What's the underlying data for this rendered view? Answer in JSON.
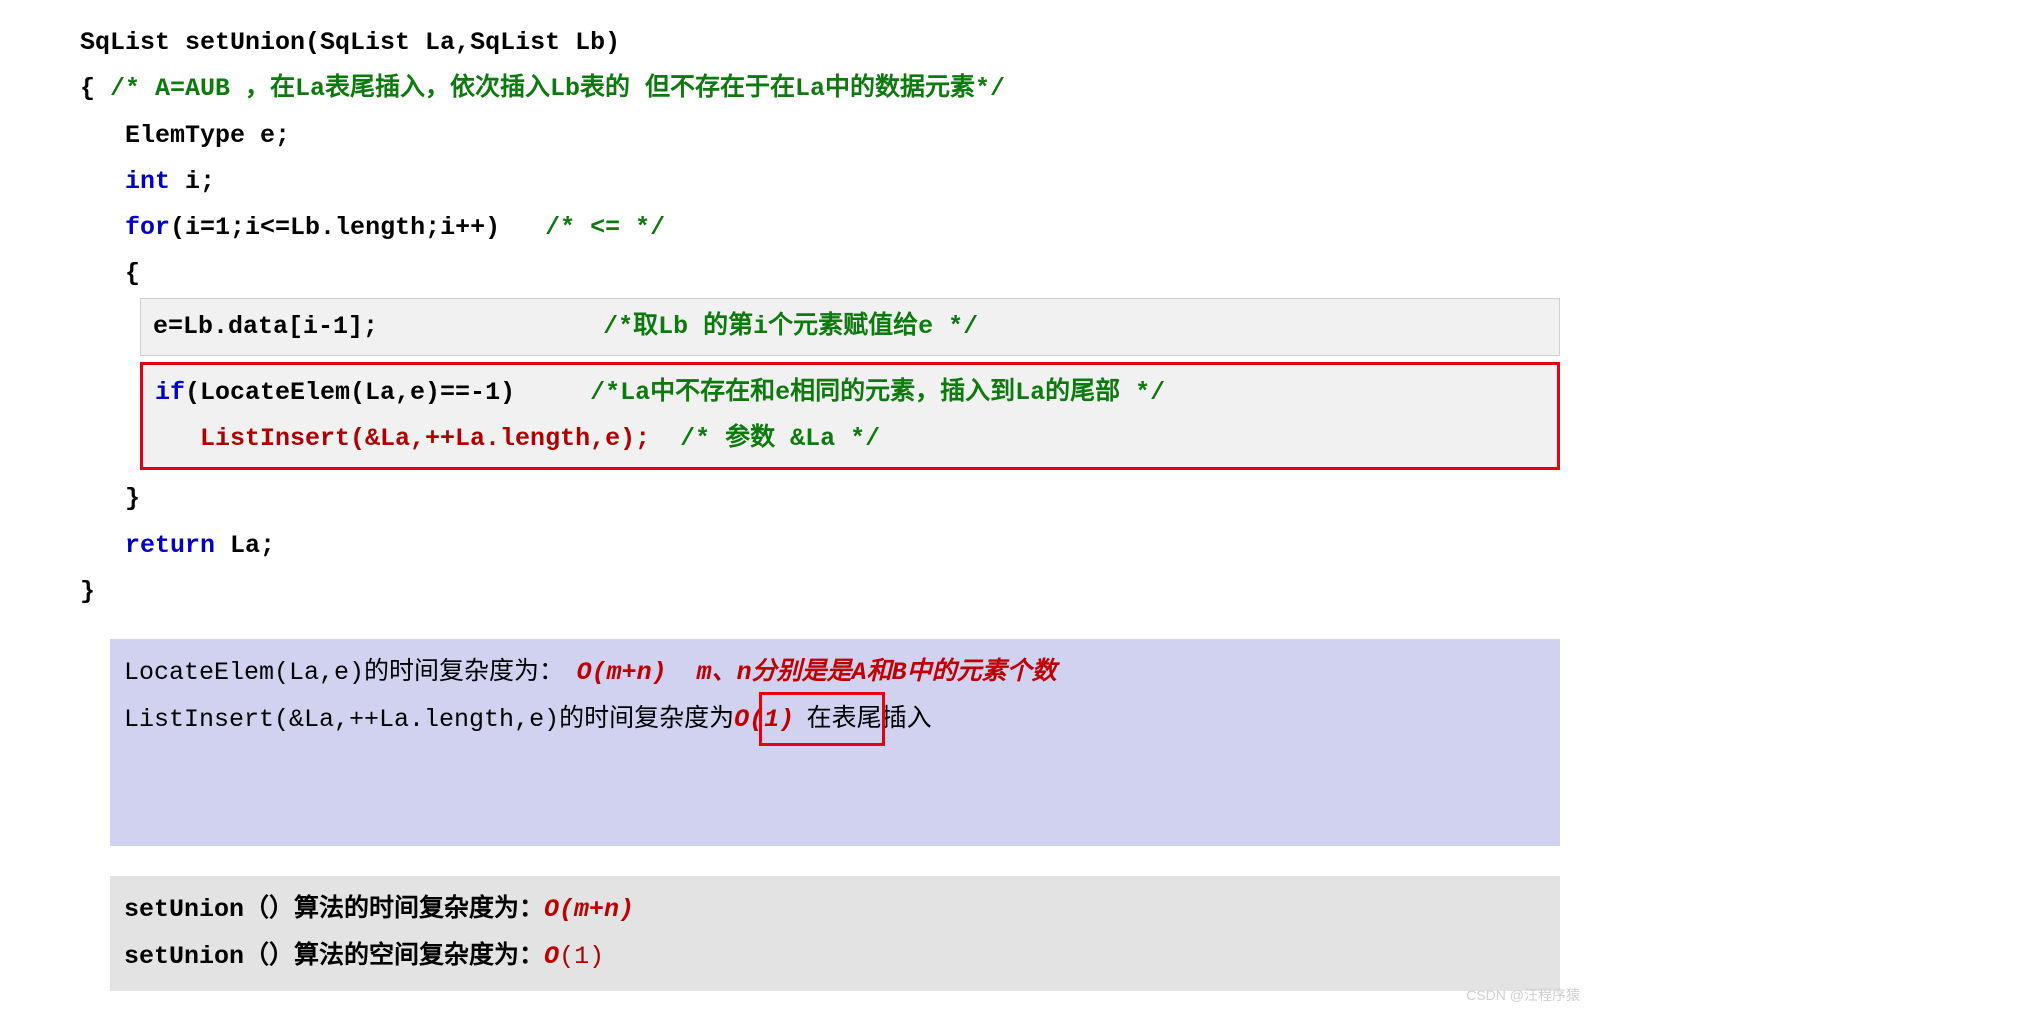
{
  "code": {
    "l1a": "SqList setUnion(SqList La,SqList Lb)",
    "l2a": "{ ",
    "l2b": "/* A=AUB ，在La表尾插入，依次插入Lb表的 但不存在于在La中的数据元素*/",
    "l3a": "   ElemType e;",
    "l4a": "   ",
    "l4b": "int",
    "l4c": " i;",
    "l5a": "   ",
    "l5b": "for",
    "l5c": "(i=1;i<=Lb.length;i++)   ",
    "l5d": "/* <= */",
    "l6a": "   {",
    "l7a": "e=Lb.data[i-1];               ",
    "l7b": "/*取Lb 的第i个元素赋值给e */",
    "l8a": "if",
    "l8b": "(LocateElem(La,e)==-1)     ",
    "l8c": "/*La中不存在和e相同的元素，插入到La的尾部 */",
    "l9a": "   ListInsert(&La,++La.length,e);  ",
    "l9b": "/* 参数 &La */",
    "l10a": "   }",
    "l11a": "   ",
    "l11b": "return",
    "l11c": " La;",
    "l12a": "}"
  },
  "note1": {
    "r1a": "LocateElem(La,e)",
    "r1b": "的时间复杂度为：  ",
    "r1c": "O(m+n)  m、n分别是是A和B中的元素个数",
    "r2a": "ListInsert(&La,++La.length,e)",
    "r2b": "的时间复杂度为",
    "r2c": "O(1)",
    "r2d": "  在表尾插入"
  },
  "note2": {
    "r1a": "setUnion（）",
    "r1b": "算法的时间复杂度为：",
    "r1c": "O(m+n)",
    "r2a": "setUnion（）",
    "r2b": "算法的空间复杂度为：",
    "r2c": "O",
    "r2d": "(1)"
  },
  "watermark": "CSDN @汪程序猿"
}
